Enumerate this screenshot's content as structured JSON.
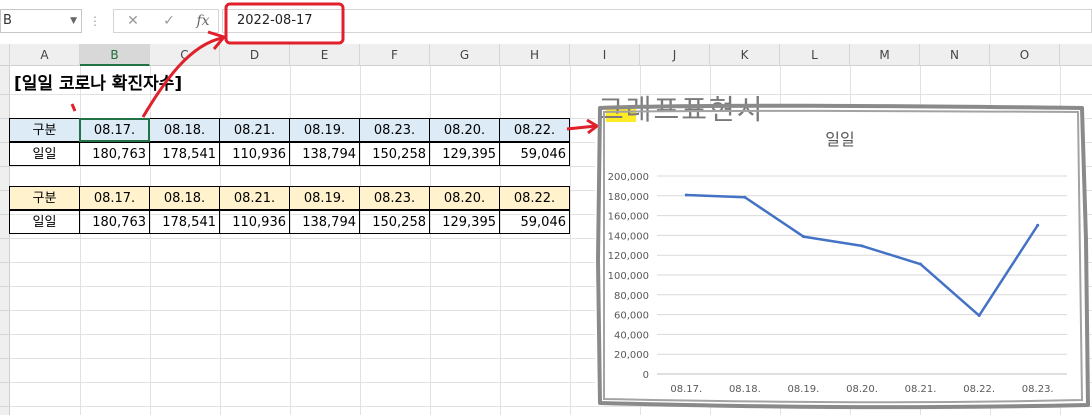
{
  "formula_bar": {
    "name_box": "B",
    "cancel_icon": "✕",
    "enter_icon": "✓",
    "function_icon": "fx",
    "value": "2022-08-17"
  },
  "columns": [
    "A",
    "B",
    "C",
    "D",
    "E",
    "F",
    "G",
    "H",
    "I",
    "J",
    "K",
    "L",
    "M",
    "N",
    "O"
  ],
  "sheet": {
    "title": "[일일 코로나 확진자수]"
  },
  "table1": {
    "header_label": "구분",
    "dates": [
      "08.17.",
      "08.18.",
      "08.21.",
      "08.19.",
      "08.23.",
      "08.20.",
      "08.22."
    ],
    "row_label": "일일",
    "values": [
      "180,763",
      "178,541",
      "110,936",
      "138,794",
      "150,258",
      "129,395",
      "59,046"
    ]
  },
  "table2": {
    "header_label": "구분",
    "dates": [
      "08.17.",
      "08.18.",
      "08.21.",
      "08.19.",
      "08.23.",
      "08.20.",
      "08.22."
    ],
    "row_label": "일일",
    "values": [
      "180,763",
      "178,541",
      "110,936",
      "138,794",
      "150,258",
      "129,395",
      "59,046"
    ]
  },
  "annotation": {
    "handwritten_text": "그래프표현시",
    "highlight_color": "#ffe600",
    "arrow_color": "#e0202a"
  },
  "chart_data": {
    "type": "line",
    "title": "일일",
    "categories": [
      "08.17.",
      "08.18.",
      "08.19.",
      "08.20.",
      "08.21.",
      "08.22.",
      "08.23."
    ],
    "series": [
      {
        "name": "",
        "values": [
          180763,
          178541,
          138794,
          129395,
          110936,
          59046,
          150258
        ],
        "color": "#4472c4"
      }
    ],
    "ylim": [
      0,
      200000
    ],
    "yticks": [
      "0",
      "20,000",
      "40,000",
      "60,000",
      "80,000",
      "100,000",
      "120,000",
      "140,000",
      "160,000",
      "180,000",
      "200,000"
    ],
    "grid": true,
    "legend": "none"
  }
}
